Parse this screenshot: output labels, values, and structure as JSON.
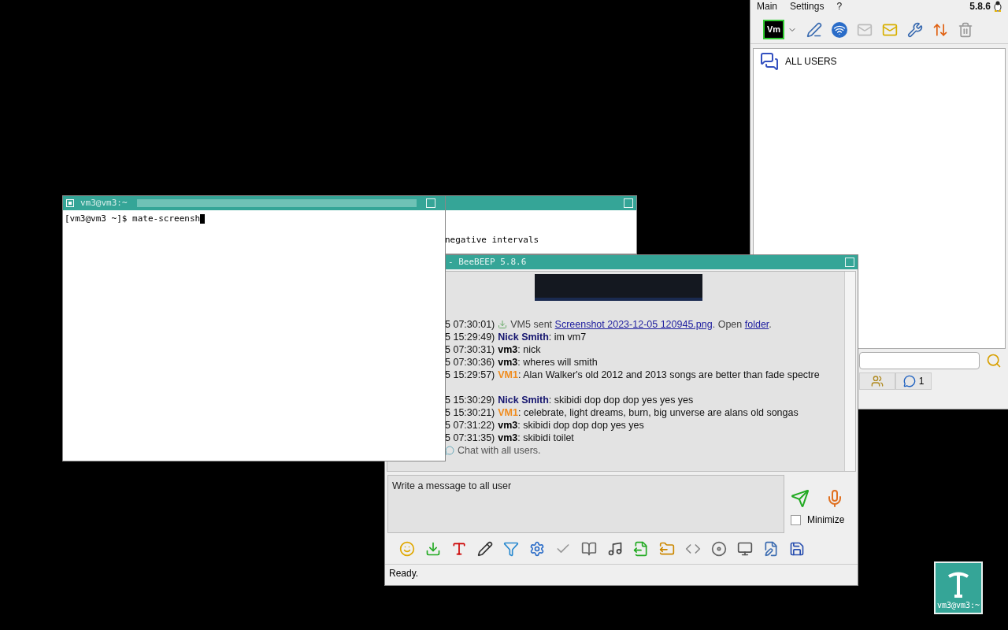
{
  "main_window": {
    "menu": [
      "Main",
      "Settings",
      "?"
    ],
    "version": "5.8.6",
    "logo": "Vm",
    "users": [
      {
        "name": "ALL USERS"
      }
    ],
    "tabs": [
      {
        "selected": false
      },
      {
        "label": "1",
        "selected": false
      }
    ]
  },
  "back_terminal": {
    "lines": [
      "negative intervals"
    ]
  },
  "terminal": {
    "title": "vm3@vm3:~",
    "prompt": "[vm3@vm3 ~]$ mate-screensh"
  },
  "chat_window": {
    "title": "- BeeBEEP 5.8.6",
    "messages": [
      {
        "kind": "file",
        "time": "5 07:30:01)",
        "text": "VM5 sent",
        "link": "Screenshot 2023-12-05 120945.png",
        "middle": ". Open",
        "link2": "folder",
        "end": "."
      },
      {
        "kind": "text",
        "time": "5 15:29:49)",
        "author": "Nick Smith",
        "color": "#14146e",
        "text": ": im vm7"
      },
      {
        "kind": "text",
        "time": "5 07:30:31)",
        "author": "vm3",
        "color": "#000000",
        "text": ": nick"
      },
      {
        "kind": "text",
        "time": "5 07:30:36)",
        "author": "vm3",
        "color": "#000000",
        "text": ": wheres will smith"
      },
      {
        "kind": "text",
        "time": "5 15:29:57)",
        "author": "VM1",
        "color": "#f08c1e",
        "text": ": Alan Walker's old 2012 and 2013 songs are better than fade spectre"
      },
      {
        "kind": "blank"
      },
      {
        "kind": "text",
        "time": "5 15:30:29)",
        "author": "Nick Smith",
        "color": "#14146e",
        "text": ": skibidi dop dop dop yes yes yes"
      },
      {
        "kind": "text",
        "time": "5 15:30:21)",
        "author": "VM1",
        "color": "#f08c1e",
        "text": ": celebrate, light dreams, burn, big unverse are alans old songas"
      },
      {
        "kind": "text",
        "time": "5 07:31:22)",
        "author": "vm3",
        "color": "#000000",
        "text": ": skibidi dop dop dop yes yes"
      },
      {
        "kind": "text",
        "time": "5 07:31:35)",
        "author": "vm3",
        "color": "#000000",
        "text": ": skibidi toilet"
      },
      {
        "kind": "system",
        "text": "Chat with all users."
      }
    ],
    "input": {
      "placeholder": "Write a message to all user"
    },
    "minimize": {
      "label": "Minimize",
      "checked": false
    },
    "status": "Ready."
  },
  "desktop_icon": {
    "label": "vm3@vm3:~"
  }
}
